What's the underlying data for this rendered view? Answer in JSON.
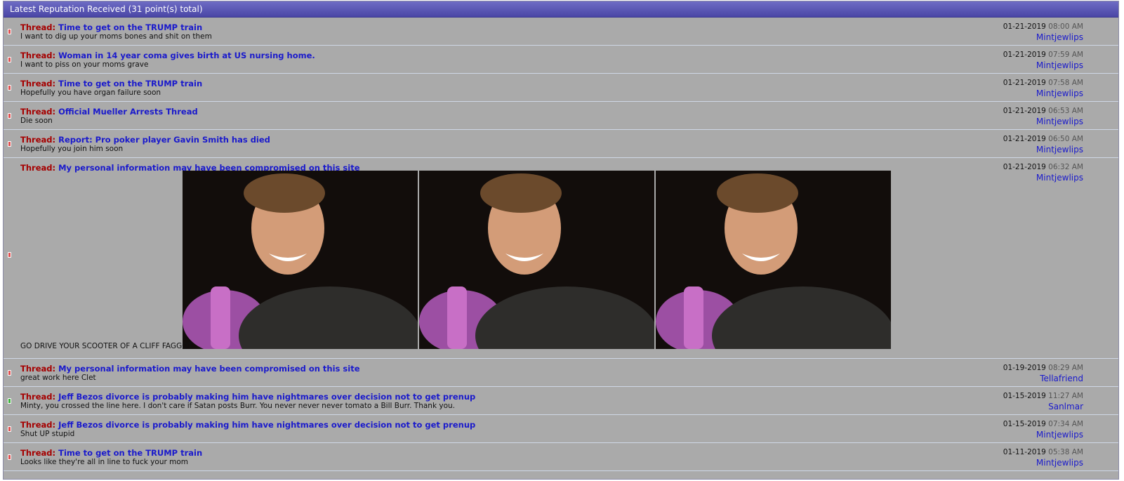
{
  "header": {
    "title": "Latest Reputation Received (31 point(s) total)"
  },
  "thread_prefix": "Thread:",
  "rows": [
    {
      "kind": "neg",
      "thread": "Time to get on the TRUMP train",
      "comment": "I want to dig up your moms bones and shit on them",
      "date": "01-21-2019",
      "time": "08:00 AM",
      "user": "Mintjewlips"
    },
    {
      "kind": "neg",
      "thread": "Woman in 14 year coma gives birth at US nursing home.",
      "comment": "I want to piss on your moms grave",
      "date": "01-21-2019",
      "time": "07:59 AM",
      "user": "Mintjewlips"
    },
    {
      "kind": "neg",
      "thread": "Time to get on the TRUMP train",
      "comment": "Hopefully you have organ failure soon",
      "date": "01-21-2019",
      "time": "07:58 AM",
      "user": "Mintjewlips"
    },
    {
      "kind": "neg",
      "thread": "Official Mueller Arrests Thread",
      "comment": "Die soon",
      "date": "01-21-2019",
      "time": "06:53 AM",
      "user": "Mintjewlips"
    },
    {
      "kind": "neg",
      "thread": "Report: Pro poker player Gavin Smith has died",
      "comment": "Hopefully you join him soon",
      "date": "01-21-2019",
      "time": "06:50 AM",
      "user": "Mintjewlips"
    },
    {
      "kind": "neg",
      "thread": "My personal information may have been compromised on this site",
      "comment": "GO DRIVE YOUR SCOOTER OF A CLIFF FAGGOT",
      "date": "01-21-2019",
      "time": "06:32 AM",
      "user": "Mintjewlips",
      "images": [
        "laughing-man-photo",
        "laughing-man-photo",
        "laughing-man-photo"
      ]
    },
    {
      "kind": "neg",
      "thread": "My personal information may have been compromised on this site",
      "comment": "great work here Clet",
      "date": "01-19-2019",
      "time": "08:29 AM",
      "user": "Tellafriend"
    },
    {
      "kind": "pos",
      "thread": "Jeff Bezos divorce is probably making him have nightmares over decision not to get prenup",
      "comment": "Minty, you crossed the line here. I don't care if Satan posts Burr. You never never never tomato a Bill Burr. Thank you.",
      "date": "01-15-2019",
      "time": "11:27 AM",
      "user": "Sanlmar"
    },
    {
      "kind": "neg",
      "thread": "Jeff Bezos divorce is probably making him have nightmares over decision not to get prenup",
      "comment": "Shut UP stupid",
      "date": "01-15-2019",
      "time": "07:34 AM",
      "user": "Mintjewlips"
    },
    {
      "kind": "neg",
      "thread": "Time to get on the TRUMP train",
      "comment": "Looks like they're all in line to fuck your mom",
      "date": "01-11-2019",
      "time": "05:38 AM",
      "user": "Mintjewlips"
    }
  ],
  "colors": {
    "header_bg": "#5552b3",
    "panel_bg": "#aaaaaa",
    "thread_prefix": "#a50000",
    "link": "#1a1acc",
    "negative_rep": "#e05050",
    "positive_rep": "#3cb33c"
  }
}
